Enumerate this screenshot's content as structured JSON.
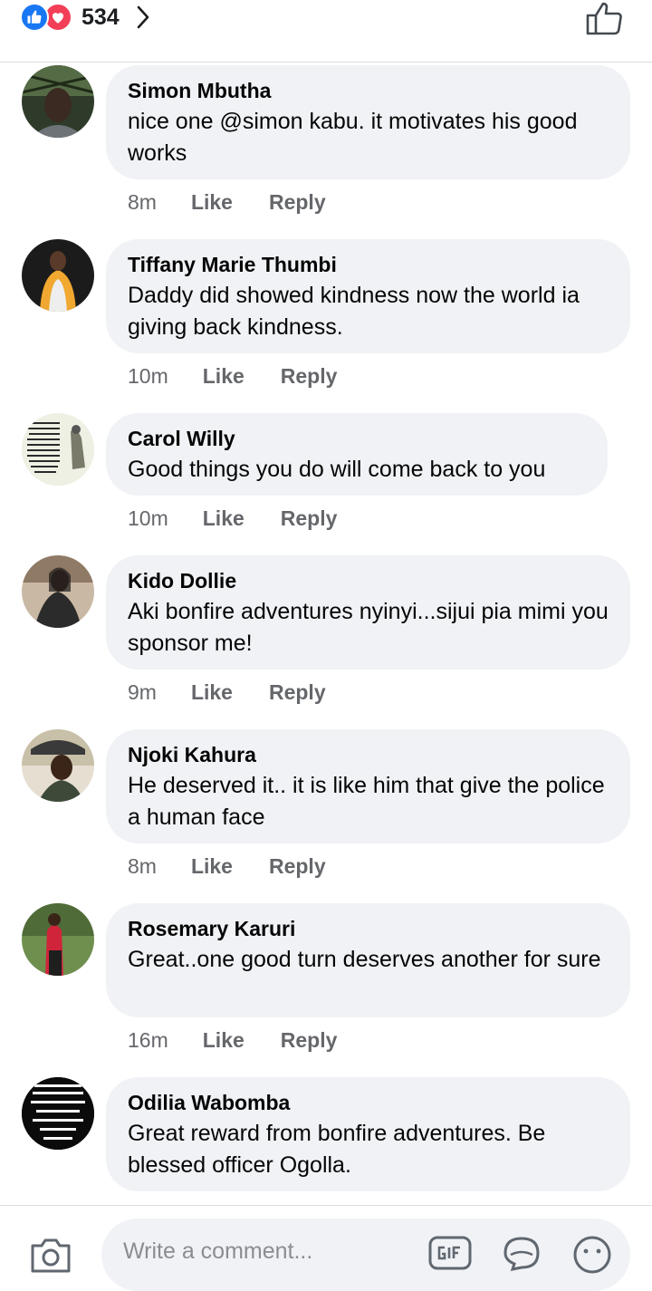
{
  "header": {
    "reaction_count": "534",
    "icons": [
      "like-reaction-icon",
      "love-reaction-icon",
      "chevron-right-icon",
      "thumbs-up-icon"
    ]
  },
  "comments": [
    {
      "author": "Simon Mbutha",
      "text": "nice one @simon kabu. it motivates his good works",
      "time": "8m",
      "like": "Like",
      "reply": "Reply"
    },
    {
      "author": "Tiffany Marie Thumbi",
      "text": "Daddy did showed kindness now the world ia giving back kindness.",
      "time": "10m",
      "like": "Like",
      "reply": "Reply"
    },
    {
      "author": "Carol Willy",
      "text": "Good things you do will come back to you",
      "time": "10m",
      "like": "Like",
      "reply": "Reply"
    },
    {
      "author": "Kido Dollie",
      "text": "Aki bonfire adventures nyinyi...sijui pia mimi you sponsor me!",
      "time": "9m",
      "like": "Like",
      "reply": "Reply"
    },
    {
      "author": "Njoki Kahura",
      "text": "He deserved it.. it is like him that give the police a human face",
      "time": "8m",
      "like": "Like",
      "reply": "Reply"
    },
    {
      "author": "Rosemary Karuri",
      "text": "Great..one good turn deserves another for sure",
      "time": "16m",
      "like": "Like",
      "reply": "Reply"
    },
    {
      "author": "Odilia Wabomba",
      "text": "Great reward from bonfire adventures. Be blessed officer Ogolla.",
      "time": "",
      "like": "",
      "reply": ""
    }
  ],
  "avatar_texts": {
    "carol": "When I am alone, God is my comforter. When I am nothing, God is my everything. When I am sad and lonely, God is my song and my joy. When I am weak helpless, God is my strength.",
    "odilia": "Miracle worker Promise keeper; Light in the darkness My God that is who you are"
  },
  "composer": {
    "placeholder": "Write a comment...",
    "icons": [
      "camera-icon",
      "gif-icon",
      "sticker-icon",
      "emoji-icon"
    ]
  },
  "colors": {
    "facebook_blue": "#1877f2",
    "love_red": "#f33e58",
    "bubble_bg": "#f0f2f5",
    "meta_gray": "#65676b"
  }
}
